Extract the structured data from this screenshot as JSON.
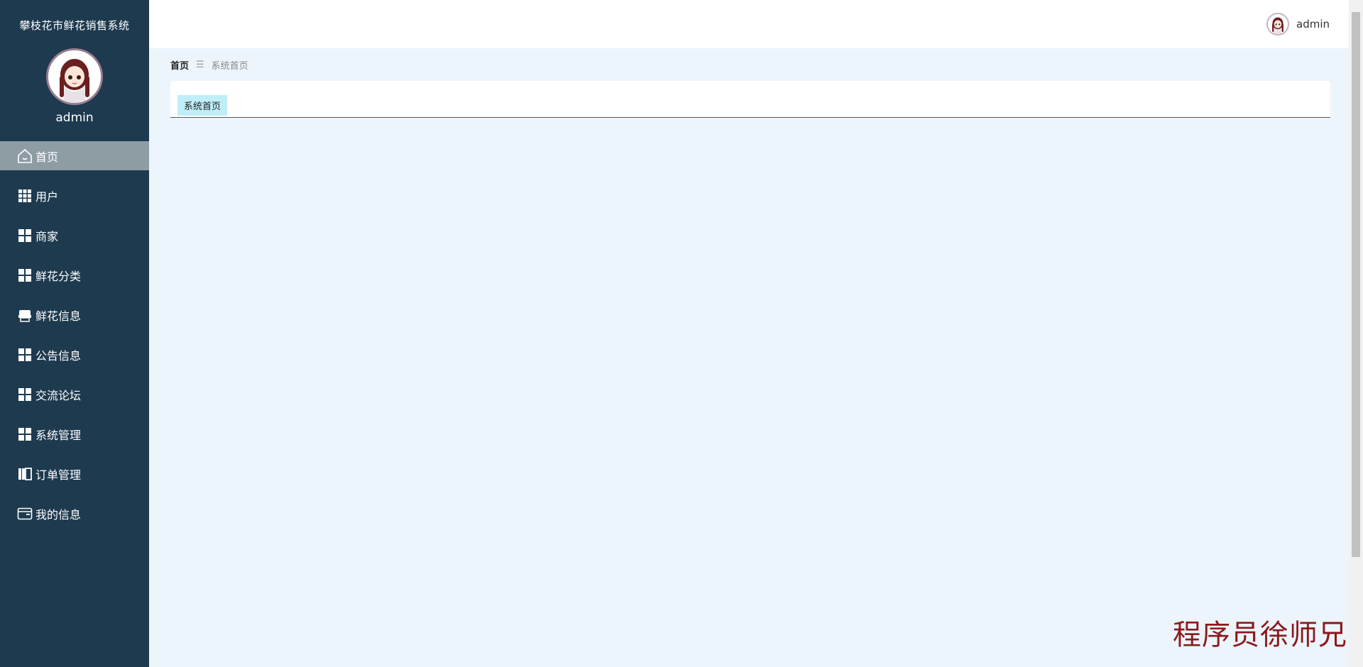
{
  "sidebar": {
    "app_title": "攀枝花市鲜花销售系统",
    "profile_name": "admin",
    "items": [
      {
        "label": "首页",
        "icon": "home-icon",
        "active": true
      },
      {
        "label": "用户",
        "icon": "grid-9-icon"
      },
      {
        "label": "商家",
        "icon": "grid-4-icon"
      },
      {
        "label": "鲜花分类",
        "icon": "grid-4-icon"
      },
      {
        "label": "鲜花信息",
        "icon": "printer-icon"
      },
      {
        "label": "公告信息",
        "icon": "grid-4-icon"
      },
      {
        "label": "交流论坛",
        "icon": "grid-4-icon"
      },
      {
        "label": "系统管理",
        "icon": "grid-4-icon"
      },
      {
        "label": "订单管理",
        "icon": "book-icon"
      },
      {
        "label": "我的信息",
        "icon": "wallet-icon"
      }
    ]
  },
  "header": {
    "user_name": "admin"
  },
  "breadcrumb": {
    "home": "首页",
    "separator": "☰",
    "current": "系统首页"
  },
  "tabs": [
    {
      "label": "系统首页"
    }
  ],
  "watermark": "程序员徐师兄",
  "colors": {
    "sidebar_bg": "#1e3a4f",
    "active_item_bg": "#8e9ca4",
    "page_bg": "#ecf5fc",
    "tab_bg": "#bfeef9",
    "watermark": "#8b1a1a"
  }
}
